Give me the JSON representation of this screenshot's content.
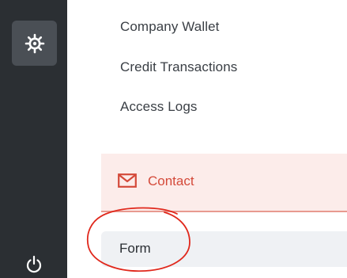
{
  "sidebar": {
    "rail_icons": [
      "gear-icon",
      "power-icon"
    ]
  },
  "menu": {
    "items": [
      {
        "label": "Company Wallet"
      },
      {
        "label": "Credit Transactions"
      },
      {
        "label": "Access Logs"
      }
    ]
  },
  "section": {
    "label": "Contact",
    "icon": "envelope-icon",
    "accent_color": "#d44a3a",
    "background_color": "#fcecea"
  },
  "sub_item": {
    "label": "Form"
  },
  "annotation": {
    "color": "#e0281c",
    "shape": "ellipse"
  }
}
